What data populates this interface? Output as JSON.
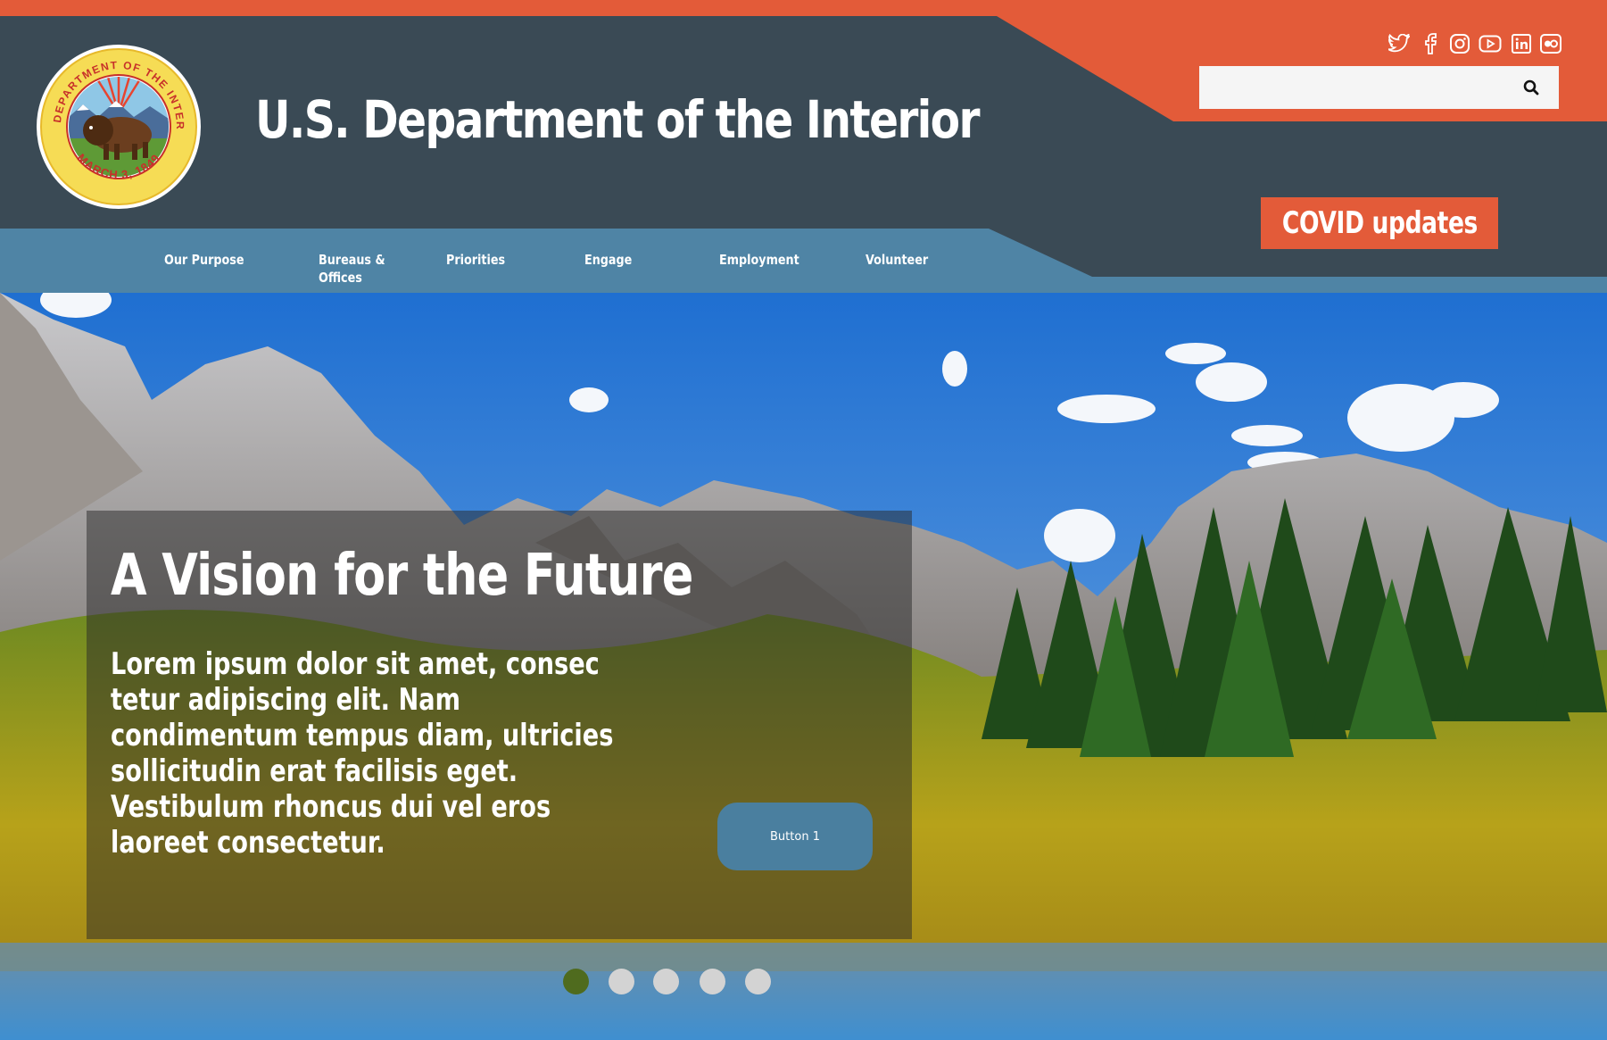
{
  "header": {
    "title": "U.S. Department of the Interior",
    "logo": {
      "text_top": "U.S. DEPARTMENT OF THE INTERIOR",
      "text_bottom": "MARCH 3, 1849"
    },
    "social": [
      {
        "name": "twitter-icon"
      },
      {
        "name": "facebook-icon"
      },
      {
        "name": "instagram-icon"
      },
      {
        "name": "youtube-icon"
      },
      {
        "name": "linkedin-icon"
      },
      {
        "name": "flickr-icon"
      }
    ],
    "search": {
      "placeholder": "",
      "value": "",
      "icon": "search-icon"
    },
    "covid_label": "COVID updates"
  },
  "nav": {
    "items": [
      {
        "label": "Our Purpose"
      },
      {
        "label": "Bureaus &\nOffices"
      },
      {
        "label": "Priorities"
      },
      {
        "label": "Engage"
      },
      {
        "label": "Employment"
      },
      {
        "label": "Volunteer"
      }
    ]
  },
  "hero": {
    "title": "A Vision for the Future",
    "text": "Lorem ipsum dolor sit amet, consec tetur adipiscing elit. Nam condimentum tempus diam, ultricies sollicitudin erat facilisis eget. Vestibulum rhoncus dui vel eros laoreet consectetur.",
    "button_label": "Button 1",
    "slides": 5,
    "active_slide": 1
  },
  "colors": {
    "header_dark": "#3a4a55",
    "accent": "#e35b39",
    "nav_blue": "#4f84a5",
    "button_blue": "#4a7f9f",
    "active_dot": "#4f6b1e"
  }
}
